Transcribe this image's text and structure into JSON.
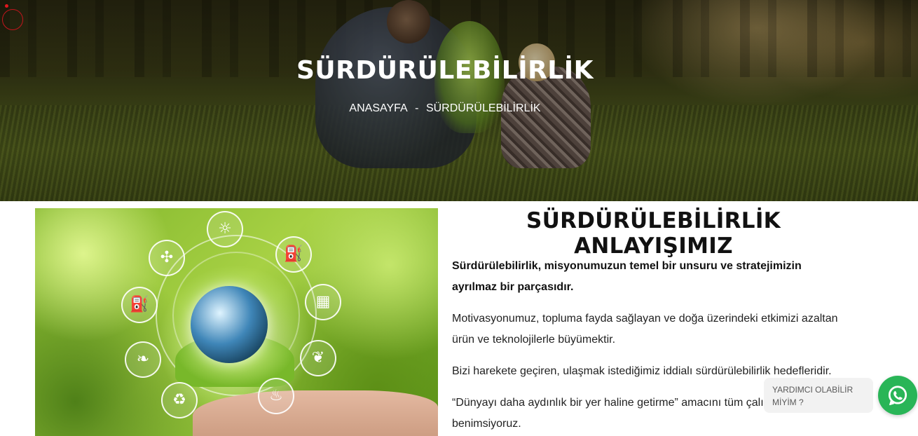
{
  "hero": {
    "title": "SÜRDÜRÜLEBİLİRLİK",
    "breadcrumb": {
      "home": "ANASAYFA",
      "separator": "-",
      "current": "SÜRDÜRÜLEBİLİRLİK"
    }
  },
  "content": {
    "title": "SÜRDÜRÜLEBİLİRLİK ANLAYIŞIMIZ",
    "paragraphs": [
      "Sürdürülebilirlik, misyonumuzun temel bir unsuru ve stratejimizin ayrılmaz bir parçasıdır.",
      "Motivasyonumuz, topluma fayda sağlayan ve doğa üzerindeki etkimizi azaltan ürün ve teknolojilerle büyümektir.",
      "Bizi harekete geçiren, ulaşmak istediğimiz iddialı sürdürülebilirlik hedefleridir.",
      " “Dünyayı daha aydınlık bir yer haline getirme” amacını tüm çalışanlarımız benimsiyoruz."
    ],
    "eco_icons": [
      "sun-icon",
      "oil-pump-icon",
      "solar-panel-icon",
      "corn-icon",
      "fire-icon",
      "recycle-icon",
      "leaf-drop-icon",
      "fuel-pump-icon",
      "wind-turbine-icon"
    ]
  },
  "whatsapp": {
    "help_text": "YARDIMCI OLABİLİR MİYİM ?",
    "icon": "whatsapp-icon",
    "color": "#29b557"
  },
  "colors": {
    "loader": "#e2161e"
  }
}
